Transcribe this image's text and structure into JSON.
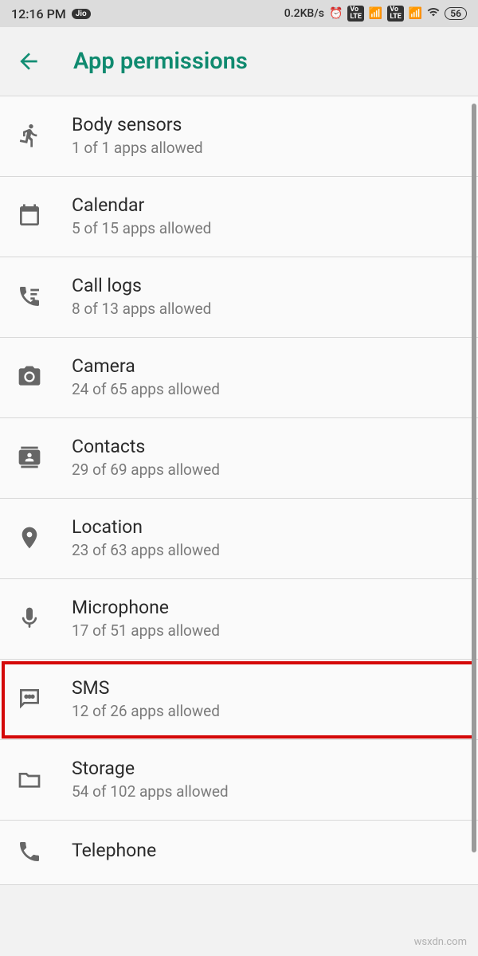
{
  "status": {
    "time": "12:16 PM",
    "carrier_badge": "Jio",
    "data_rate": "0.2KB/s",
    "volte1": "Vo LTE",
    "volte2": "Vo LTE",
    "battery": "56"
  },
  "header": {
    "title": "App permissions"
  },
  "permissions": [
    {
      "icon": "running",
      "title": "Body sensors",
      "sub": "1 of 1 apps allowed"
    },
    {
      "icon": "calendar",
      "title": "Calendar",
      "sub": "5 of 15 apps allowed"
    },
    {
      "icon": "calllog",
      "title": "Call logs",
      "sub": "8 of 13 apps allowed"
    },
    {
      "icon": "camera",
      "title": "Camera",
      "sub": "24 of 65 apps allowed"
    },
    {
      "icon": "contacts",
      "title": "Contacts",
      "sub": "29 of 69 apps allowed"
    },
    {
      "icon": "location",
      "title": "Location",
      "sub": "23 of 63 apps allowed"
    },
    {
      "icon": "mic",
      "title": "Microphone",
      "sub": "17 of 51 apps allowed"
    },
    {
      "icon": "sms",
      "title": "SMS",
      "sub": "12 of 26 apps allowed",
      "highlight": true
    },
    {
      "icon": "storage",
      "title": "Storage",
      "sub": "54 of 102 apps allowed"
    },
    {
      "icon": "phone",
      "title": "Telephone",
      "sub": ""
    }
  ],
  "watermark": "wsxdn.com"
}
